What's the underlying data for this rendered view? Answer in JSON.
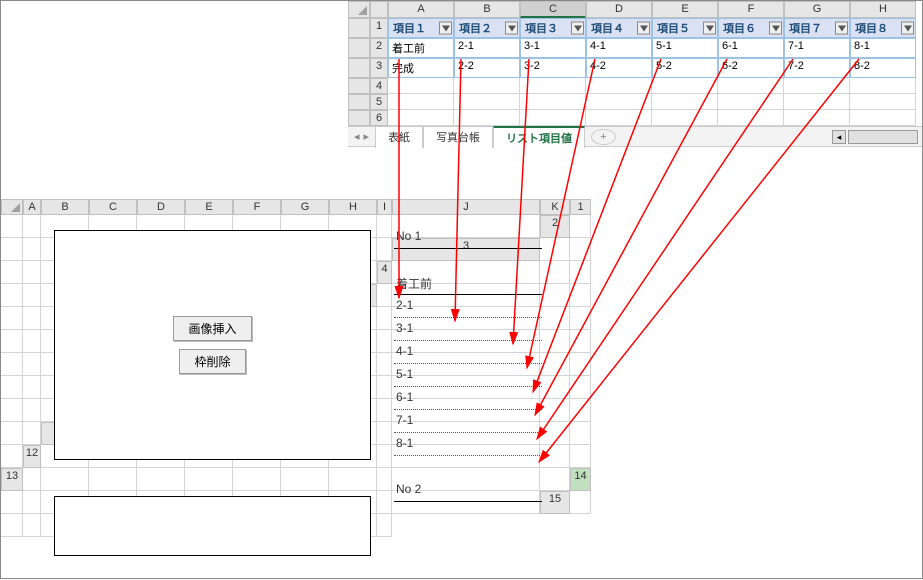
{
  "topSheet": {
    "columns": [
      "A",
      "B",
      "C",
      "D",
      "E",
      "F",
      "G",
      "H"
    ],
    "selectedCol": "C",
    "headers": [
      "項目１",
      "項目２",
      "項目３",
      "項目４",
      "項目５",
      "項目６",
      "項目７",
      "項目８"
    ],
    "rows": [
      [
        "着工前",
        "2-1",
        "3-1",
        "4-1",
        "5-1",
        "6-1",
        "7-1",
        "8-1"
      ],
      [
        "完成",
        "2-2",
        "3-2",
        "4-2",
        "5-2",
        "6-2",
        "7-2",
        "8-2"
      ]
    ],
    "emptyRows": 3,
    "tabs": [
      "表紙",
      "写真台帳",
      "リスト項目値"
    ],
    "activeTab": "リスト項目値"
  },
  "bottomSheet": {
    "columns": [
      "A",
      "B",
      "C",
      "D",
      "E",
      "F",
      "G",
      "H",
      "I",
      "J",
      "K"
    ],
    "rowCount": 15,
    "selectedRow": 14,
    "buttons": {
      "insert": "画像挿入",
      "delete": "枠削除"
    },
    "details": {
      "no1": "No 1",
      "items": [
        "着工前",
        "2-1",
        "3-1",
        "4-1",
        "5-1",
        "6-1",
        "7-1",
        "8-1"
      ],
      "no2": "No 2"
    }
  },
  "chart_data": {
    "type": "table",
    "title": "リスト項目値",
    "columns": [
      "項目１",
      "項目２",
      "項目３",
      "項目４",
      "項目５",
      "項目６",
      "項目７",
      "項目８"
    ],
    "rows": [
      [
        "着工前",
        "2-1",
        "3-1",
        "4-1",
        "5-1",
        "6-1",
        "7-1",
        "8-1"
      ],
      [
        "完成",
        "2-2",
        "3-2",
        "4-2",
        "5-2",
        "6-2",
        "7-2",
        "8-2"
      ]
    ]
  }
}
